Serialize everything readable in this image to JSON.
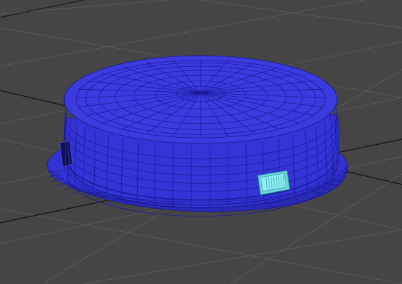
{
  "viewport": {
    "label": "",
    "background_color": "#454545",
    "grid": {
      "minor_color": "#5a5a5a",
      "major_color": "#111111"
    }
  },
  "objects": [
    {
      "name": "round-cushion-mesh",
      "shape": "cylinder-with-domed-top-and-flange",
      "wireframe_color": "#1a1aa0",
      "fill_color": "#3a3ad8",
      "selected": true
    },
    {
      "name": "side-label-tag",
      "shape": "box",
      "fill_color": "#7fe3ea",
      "edge_color": "#1e8a8f"
    }
  ]
}
